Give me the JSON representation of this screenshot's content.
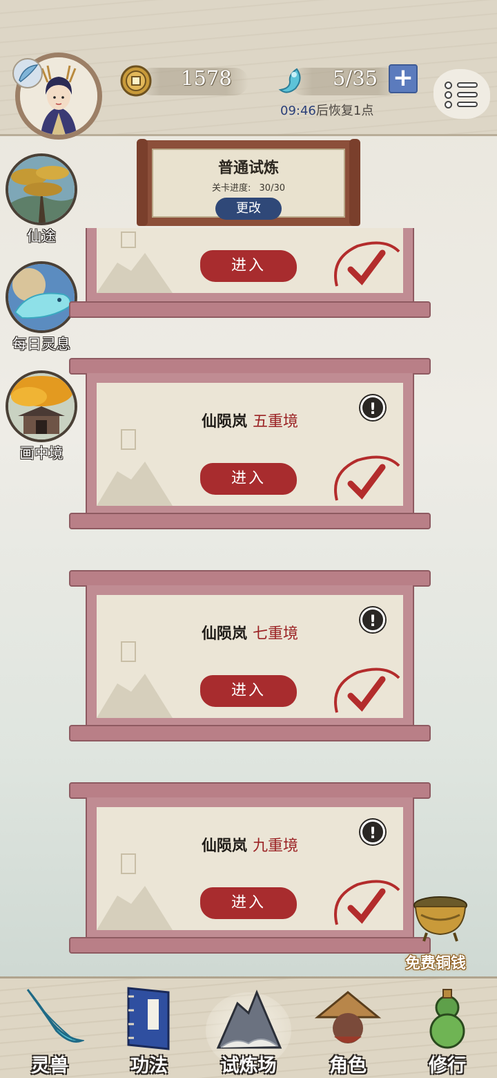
{
  "topbar": {
    "coins": "1578",
    "energy": "5/35",
    "recover_time": "09:46",
    "recover_suffix": "后恢复1点",
    "plus_symbol": "+"
  },
  "header": {
    "title": "普通试炼",
    "progress_label": "关卡进度:",
    "progress_value": "30/30",
    "change_label": "更改"
  },
  "side": {
    "xiantu": "仙途",
    "daily": "每日灵息",
    "painting": "画中境"
  },
  "stages": [
    {
      "name": "",
      "level": "",
      "enter": "进入"
    },
    {
      "name": "仙陨岚",
      "level": "五重境",
      "enter": "进入",
      "info": "!"
    },
    {
      "name": "仙陨岚",
      "level": "七重境",
      "enter": "进入",
      "info": "!"
    },
    {
      "name": "仙陨岚",
      "level": "九重境",
      "enter": "进入",
      "info": "!"
    }
  ],
  "free_coin": "免费铜钱",
  "nav": {
    "beast": "灵兽",
    "skills": "功法",
    "trial": "试炼场",
    "character": "角色",
    "cultivate": "修行"
  },
  "colors": {
    "enter_red": "#a82c2e",
    "level_red": "#9b2325",
    "change_blue": "#2f4878",
    "card_frame": "#c08c93"
  }
}
